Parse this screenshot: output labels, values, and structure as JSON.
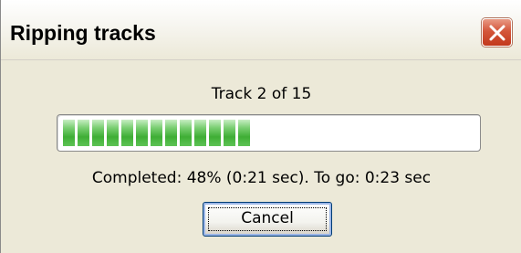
{
  "window": {
    "title": "Ripping tracks",
    "close_icon": "close-icon"
  },
  "track": {
    "label": "Track 2 of 15",
    "current": 2,
    "total": 15
  },
  "progress": {
    "fraction": 0.48,
    "color": "#3fae35"
  },
  "status": {
    "text": "Completed: 48% (0:21 sec). To go: 0:23 sec"
  },
  "buttons": {
    "cancel_label": "Cancel"
  }
}
